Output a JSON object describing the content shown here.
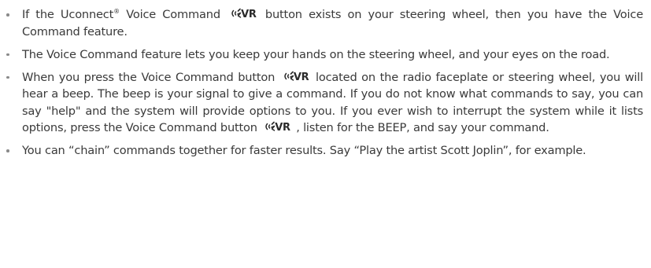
{
  "bullets": {
    "b1_pre": "If the Uconnect",
    "b1_reg": "®",
    "b1_mid": " Voice Command ",
    "b1_post": " button exists on your steering wheel, then you have the Voice Command feature.",
    "b2": "The Voice Command feature lets you keep your hands on the steering wheel, and your eyes on the road.",
    "b3_pre": "When you press the Voice Command button ",
    "b3_mid": " located on the radio faceplate or steering wheel, you will hear a beep. The beep is your signal to give a command. If you do not know what commands to say, you can say \"help\" and the system will provide options to you. If you ever wish to interrupt the system while it lists options, press the Voice Command button ",
    "b3_post": " , listen for the BEEP, and say your command.",
    "b4": "You can “chain” commands together for faster results. Say “Play the artist Scott Joplin”, for example."
  },
  "icons": {
    "vr_label": "VR",
    "vr_icon_name": "voice-recognition-icon"
  }
}
